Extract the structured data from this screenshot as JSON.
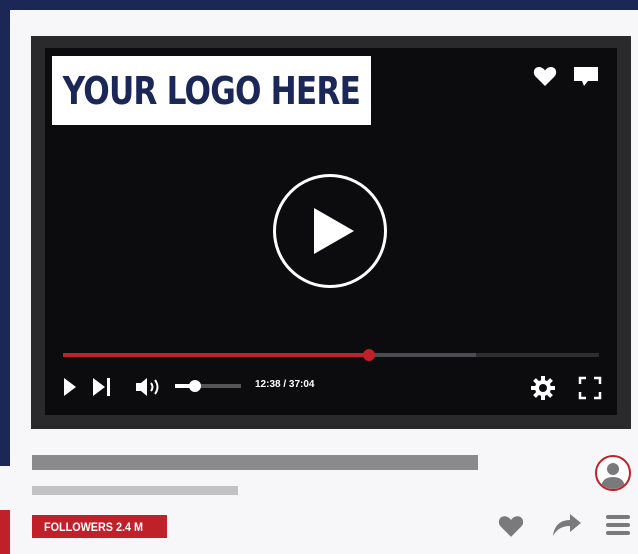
{
  "logo": {
    "text": "YOUR LOGO HERE"
  },
  "player": {
    "progress_fraction": 0.57,
    "buffered_fraction": 0.77,
    "volume_fraction": 0.3,
    "time_display": "12:38 / 37:04"
  },
  "channel": {
    "followers_label": "FOLLOWERS 2.4 M"
  },
  "colors": {
    "brand_navy": "#1b2757",
    "accent_red": "#c0202a",
    "screen_bg": "#0c0b0e",
    "icon_gray": "#7a7a7c"
  },
  "icons": {
    "top": [
      "heart-icon",
      "comment-icon"
    ],
    "controls": [
      "play-icon",
      "skip-next-icon",
      "volume-icon",
      "settings-icon",
      "fullscreen-icon"
    ],
    "bottom": [
      "heart-icon",
      "share-icon",
      "menu-icon"
    ]
  }
}
